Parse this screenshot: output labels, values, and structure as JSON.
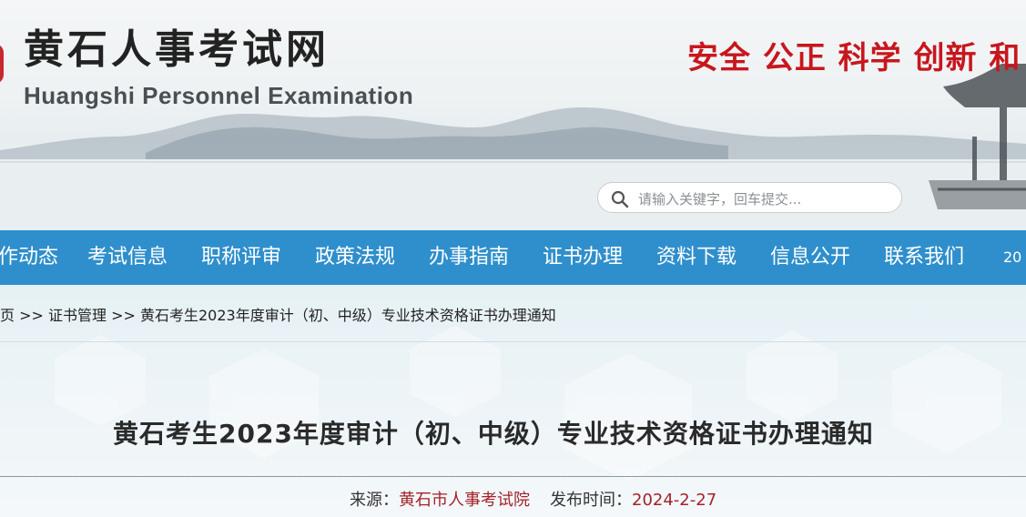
{
  "header": {
    "site_title": "黄石人事考试网",
    "site_subtitle": "Huangshi Personnel Examination",
    "slogan": "安全 公正 科学 创新 和",
    "search_placeholder": "请输入关键字，回车提交..."
  },
  "nav": {
    "items": [
      "作动态",
      "考试信息",
      "职称评审",
      "政策法规",
      "办事指南",
      "证书办理",
      "资料下载",
      "信息公开",
      "联系我们",
      "20"
    ]
  },
  "breadcrumb": {
    "home": "页",
    "sep1": " >> ",
    "section": "证书管理",
    "sep2": " >> ",
    "current": "黄石考生2023年度审计（初、中级）专业技术资格证书办理通知"
  },
  "article": {
    "title": "黄石考生2023年度审计（初、中级）专业技术资格证书办理通知",
    "source_label": "来源：",
    "source_value": "黄石市人事考试院",
    "date_label": "发布时间：",
    "date_value": "2024-2-27"
  },
  "colors": {
    "nav_bg": "#2f8fcc",
    "slogan": "#c8161d",
    "meta_value": "#a3232b"
  }
}
